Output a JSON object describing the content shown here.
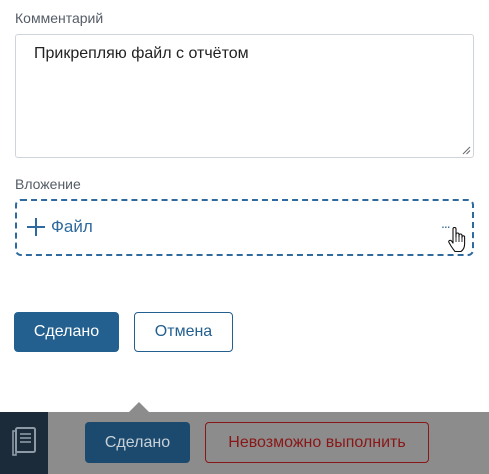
{
  "form": {
    "comment_label": "Комментарий",
    "comment_value": "Прикрепляю файл с отчётом",
    "attachment_label": "Вложение",
    "add_file_label": "Файл",
    "more_label": "..."
  },
  "actions": {
    "done_label": "Сделано",
    "cancel_label": "Отмена"
  },
  "bottom_bar": {
    "done_label": "Сделано",
    "cannot_complete_label": "Невозможно выполнить"
  },
  "colors": {
    "accent": "#24608f",
    "danger": "#8a1717"
  }
}
